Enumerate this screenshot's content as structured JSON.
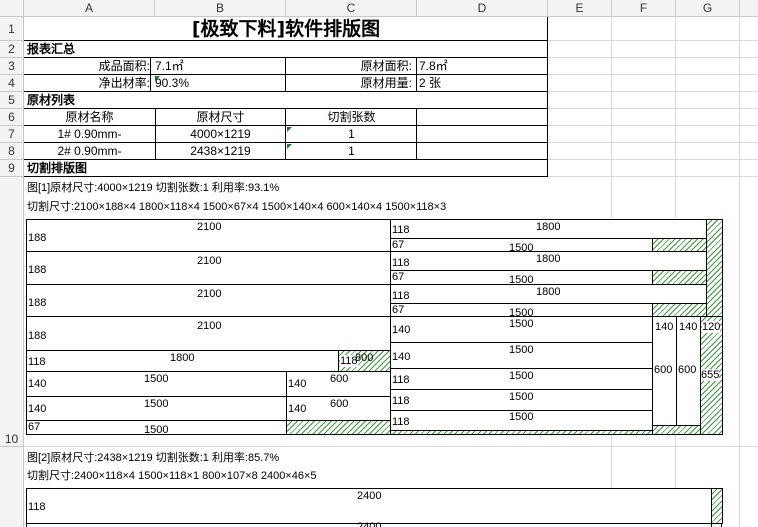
{
  "sheet": {
    "columns": [
      "A",
      "B",
      "C",
      "D",
      "E",
      "F",
      "G"
    ],
    "rows": [
      "1",
      "2",
      "3",
      "4",
      "5",
      "6",
      "7",
      "8",
      "9",
      "10"
    ]
  },
  "title": "[极致下料]软件排版图",
  "summary": {
    "heading": "报表汇总",
    "product_area_label": "成品面积:",
    "product_area_value": "7.1㎡",
    "material_area_label": "原材面积:",
    "material_area_value": "7.8㎡",
    "net_rate_label": "净出材率:",
    "net_rate_value": "90.3%",
    "material_usage_label": "原材用量:",
    "material_usage_value": "2 张"
  },
  "material_list": {
    "heading": "原材列表",
    "headers": [
      "原材名称",
      "原材尺寸",
      "切割张数"
    ],
    "rows": [
      {
        "name": "1# 0.90mm-",
        "size": "4000×1219",
        "count": "1"
      },
      {
        "name": "2# 0.90mm-",
        "size": "2438×1219",
        "count": "1"
      }
    ]
  },
  "layout": {
    "heading": "切割排版图",
    "fig1_info": "图[1]原材尺寸:4000×1219  切割张数:1  利用率:93.1%",
    "fig1_cuts": "切割尺寸:2100×188×4  1800×118×4  1500×67×4  1500×140×4  600×140×4  1500×118×3",
    "fig2_info": "图[2]原材尺寸:2438×1219  切割张数:1  利用率:85.7%",
    "fig2_cuts": "切割尺寸:2400×118×4  1500×118×1  800×107×8  2400×46×5",
    "labels": {
      "w2100": "2100",
      "h188": "188",
      "w1800": "1800",
      "h118": "118",
      "w1500": "1500",
      "h67": "67",
      "h140": "140",
      "w600": "600",
      "w800": "800",
      "h120": "120",
      "h655": "655",
      "w2400": "2400"
    }
  }
}
